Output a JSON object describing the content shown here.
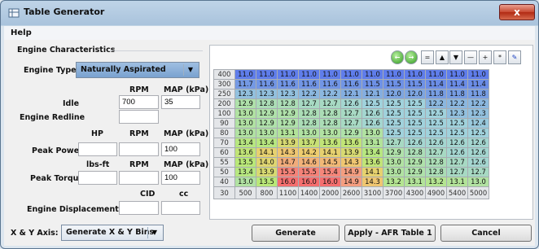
{
  "window": {
    "title": "Table Generator",
    "close_label": "x"
  },
  "menu": {
    "help": "Help"
  },
  "engine": {
    "section_title": "Engine Characteristics",
    "type_label": "Engine Type:",
    "type_value": "Naturally Aspirated",
    "rpm_header": "RPM",
    "map_header": "MAP (kPa)",
    "idle_label": "Idle",
    "idle_rpm": "700",
    "idle_map": "35",
    "redline_label": "Engine Redline",
    "redline_rpm": "",
    "hp_header": "HP",
    "rpm_header2": "RPM",
    "map_header2": "MAP (kPa)",
    "peak_power_label": "Peak Power",
    "peak_power_hp": "",
    "peak_power_rpm": "",
    "peak_power_map": "100",
    "torque_header": "lbs-ft",
    "rpm_header3": "RPM",
    "map_header3": "MAP (kPa)",
    "peak_torque_label": "Peak Torque",
    "peak_torque_lbsft": "",
    "peak_torque_rpm": "",
    "peak_torque_map": "100",
    "cid_header": "CID",
    "cc_header": "cc",
    "displacement_label": "Engine Displacement",
    "displacement_cid": "",
    "displacement_cc": ""
  },
  "axis": {
    "label": "X & Y Axis:",
    "value": "Generate X & Y Bins"
  },
  "buttons": {
    "generate": "Generate",
    "apply": "Apply - AFR Table 1",
    "cancel": "Cancel"
  },
  "toolbar": [
    "go-back",
    "go-forward",
    "set-equal",
    "increase",
    "decrease",
    "add",
    "subtract",
    "multiply",
    "edit"
  ],
  "table": {
    "y_axis": [
      "400",
      "300",
      "250",
      "200",
      "100",
      "90",
      "80",
      "70",
      "60",
      "55",
      "50",
      "40",
      "30"
    ],
    "x_axis": [
      "500",
      "800",
      "1100",
      "1400",
      "2000",
      "2600",
      "3100",
      "3700",
      "4300",
      "4900",
      "5400",
      "5000"
    ],
    "rows": [
      [
        "11.0",
        "11.0",
        "11.0",
        "11.0",
        "11.0",
        "11.0",
        "11.0",
        "11.0",
        "11.0",
        "11.0",
        "11.0",
        "11.0"
      ],
      [
        "11.7",
        "11.6",
        "11.6",
        "11.6",
        "11.6",
        "11.6",
        "11.5",
        "11.5",
        "11.5",
        "11.4",
        "11.4",
        "11.4"
      ],
      [
        "12.3",
        "12.3",
        "12.3",
        "12.2",
        "12.2",
        "12.1",
        "12.1",
        "12.0",
        "12.0",
        "11.8",
        "11.8",
        "11.8"
      ],
      [
        "12.9",
        "12.8",
        "12.8",
        "12.7",
        "12.7",
        "12.6",
        "12.5",
        "12.5",
        "12.5",
        "12.2",
        "12.2",
        "12.2"
      ],
      [
        "13.0",
        "12.9",
        "12.9",
        "12.8",
        "12.8",
        "12.7",
        "12.6",
        "12.5",
        "12.5",
        "12.5",
        "12.3",
        "12.3"
      ],
      [
        "13.0",
        "12.9",
        "12.9",
        "12.8",
        "12.8",
        "12.7",
        "12.6",
        "12.5",
        "12.5",
        "12.5",
        "12.5",
        "12.4"
      ],
      [
        "13.0",
        "13.0",
        "13.1",
        "13.0",
        "13.0",
        "12.9",
        "13.0",
        "12.5",
        "12.5",
        "12.5",
        "12.5",
        "12.5"
      ],
      [
        "13.4",
        "13.4",
        "13.9",
        "13.7",
        "13.6",
        "13.6",
        "13.1",
        "12.7",
        "12.6",
        "12.6",
        "12.6",
        "12.6"
      ],
      [
        "13.6",
        "14.1",
        "14.3",
        "14.2",
        "14.1",
        "13.9",
        "13.4",
        "12.9",
        "12.8",
        "12.7",
        "12.6",
        "12.6"
      ],
      [
        "13.5",
        "14.0",
        "14.7",
        "14.6",
        "14.5",
        "14.3",
        "13.6",
        "13.0",
        "12.9",
        "12.8",
        "12.7",
        "12.6"
      ],
      [
        "13.4",
        "13.9",
        "15.5",
        "15.5",
        "15.4",
        "14.9",
        "14.1",
        "13.0",
        "12.9",
        "12.8",
        "12.7",
        "12.7"
      ],
      [
        "13.0",
        "13.5",
        "16.0",
        "16.0",
        "16.0",
        "14.9",
        "14.3",
        "13.2",
        "13.1",
        "13.2",
        "13.1",
        "13.0"
      ]
    ]
  }
}
